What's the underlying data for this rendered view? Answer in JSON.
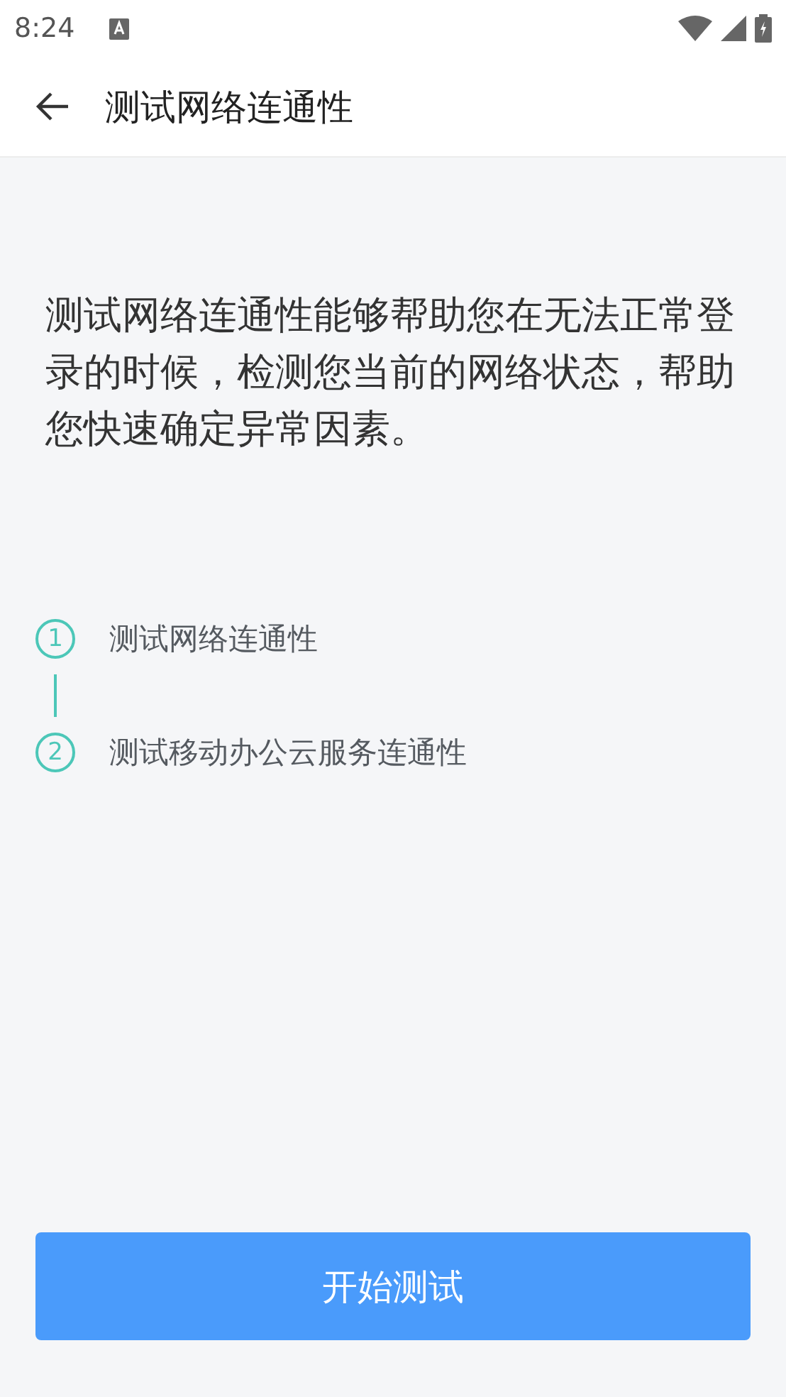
{
  "status_bar": {
    "time": "8:24"
  },
  "app_bar": {
    "title": "测试网络连通性"
  },
  "intro": "测试网络连通性能够帮助您在无法正常登录的时候，检测您当前的网络状态，帮助您快速确定异常因素。",
  "steps": [
    {
      "number": "1",
      "label": "测试网络连通性"
    },
    {
      "number": "2",
      "label": "测试移动办公云服务连通性"
    }
  ],
  "button": "开始测试"
}
